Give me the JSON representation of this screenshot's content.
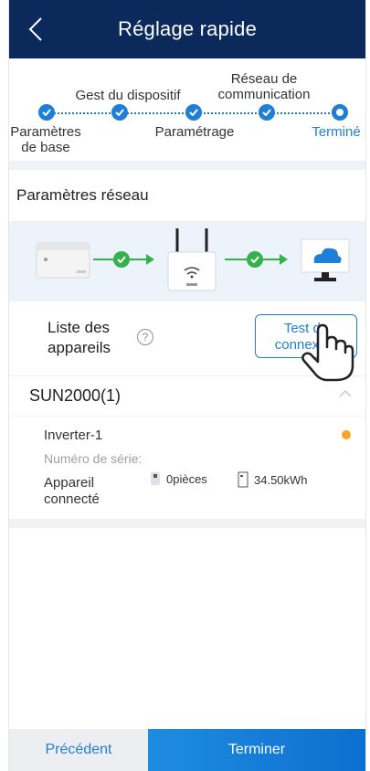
{
  "header": {
    "title": "Réglage rapide",
    "back_icon": "chevron-left-icon"
  },
  "steps": [
    {
      "label": "Paramètres\nde base",
      "state": "done"
    },
    {
      "label": "Gest du dispositif",
      "state": "done"
    },
    {
      "label": "Paramétrage",
      "state": "done"
    },
    {
      "label": "Réseau de\ncommunication",
      "state": "done"
    },
    {
      "label": "Terminé",
      "state": "current"
    }
  ],
  "network": {
    "title": "Paramètres réseau",
    "icons": [
      "inverter-icon",
      "router-icon",
      "cloud-monitor-icon"
    ],
    "link_color": "#35b14b"
  },
  "device_list": {
    "label_line1": "Liste des",
    "label_line2": "appareils",
    "help_icon": "help-circle-icon",
    "help_glyph": "?",
    "test_button_line1": "Test de",
    "test_button_line2": "connexion"
  },
  "group": {
    "name": "SUN2000(1)"
  },
  "inverter": {
    "name": "Inverter-1",
    "serial_label": "Numéro de série:",
    "connected_line1": "Appareil",
    "connected_line2": "connecté",
    "pieces": "0pièces",
    "energy": "34.50kWh",
    "status_color": "#f5a623"
  },
  "footer": {
    "prev": "Précédent",
    "finish": "Terminer"
  },
  "colors": {
    "header": "#0b2a5b",
    "accent": "#1f7fd6"
  }
}
